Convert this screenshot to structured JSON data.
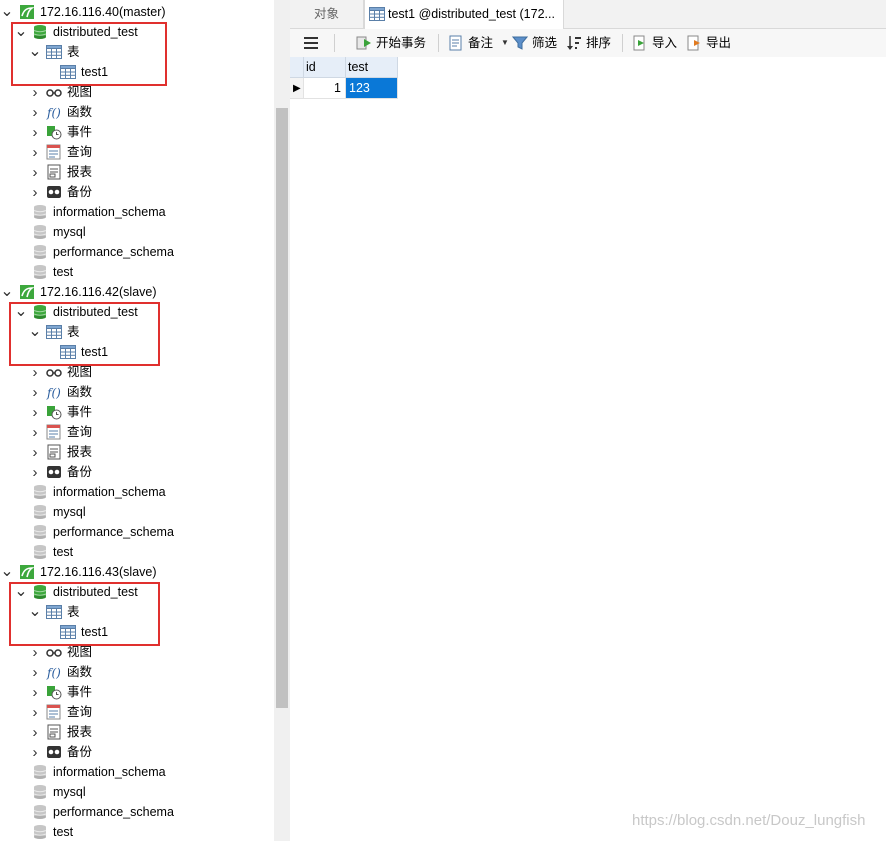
{
  "sidebar": {
    "servers": [
      {
        "name": "172.16.116.40(master)",
        "db": "distributed_test",
        "tables_label": "表",
        "table": "test1",
        "nodes": [
          "视图",
          "函数",
          "事件",
          "查询",
          "报表",
          "备份"
        ],
        "other_dbs": [
          "information_schema",
          "mysql",
          "performance_schema",
          "test"
        ]
      },
      {
        "name": "172.16.116.42(slave)",
        "db": "distributed_test",
        "tables_label": "表",
        "table": "test1",
        "nodes": [
          "视图",
          "函数",
          "事件",
          "查询",
          "报表",
          "备份"
        ],
        "other_dbs": [
          "information_schema",
          "mysql",
          "performance_schema",
          "test"
        ]
      },
      {
        "name": "172.16.116.43(slave)",
        "db": "distributed_test",
        "tables_label": "表",
        "table": "test1",
        "nodes": [
          "视图",
          "函数",
          "事件",
          "查询",
          "报表",
          "备份"
        ],
        "other_dbs": [
          "information_schema",
          "mysql",
          "performance_schema",
          "test"
        ]
      }
    ]
  },
  "tabs": {
    "objects": "对象",
    "active": "test1 @distributed_test (172..."
  },
  "toolbar": {
    "begin_transaction": "开始事务",
    "note": "备注",
    "filter": "筛选",
    "sort": "排序",
    "import": "导入",
    "export": "导出"
  },
  "grid": {
    "columns": [
      "id",
      "test"
    ],
    "rows": [
      [
        "1",
        "123"
      ]
    ]
  },
  "watermark": "https://blog.csdn.net/Douz_lungfish",
  "colors": {
    "highlight_box": "#e0302e",
    "selected_cell": "#0a78d7",
    "db_green": "#3da83d"
  }
}
